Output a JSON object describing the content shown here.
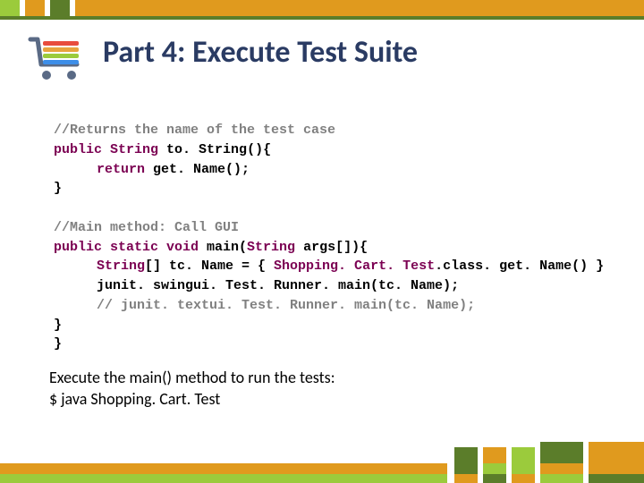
{
  "title": "Part 4: Execute Test Suite",
  "code": {
    "c1": "//Returns the name of the test case",
    "sig1_kw1": "public",
    "sig1_type": "String",
    "sig1_name": " to. String(){",
    "ret_kw": "return",
    "ret_call": " get. Name();",
    "brace": "}",
    "blank": "",
    "c2": "//Main method: Call GUI",
    "sig2_kw": "public static void",
    "sig2_name": " main(",
    "sig2_arg_type": "String",
    "sig2_arg": " args[]){",
    "l1_type": "String",
    "l1_rest1": "[] tc. Name = { ",
    "l1_cls": "Shopping. Cart. Test",
    "l1_rest2": ".class. get. Name() }",
    "l2": "junit. swingui. Test. Runner. main(tc. Name);",
    "l3": "// junit. textui. Test. Runner. main(tc. Name);"
  },
  "note": {
    "line1": "Execute the main() method to run the tests:",
    "line2": "$ java Shopping. Cart. Test"
  }
}
